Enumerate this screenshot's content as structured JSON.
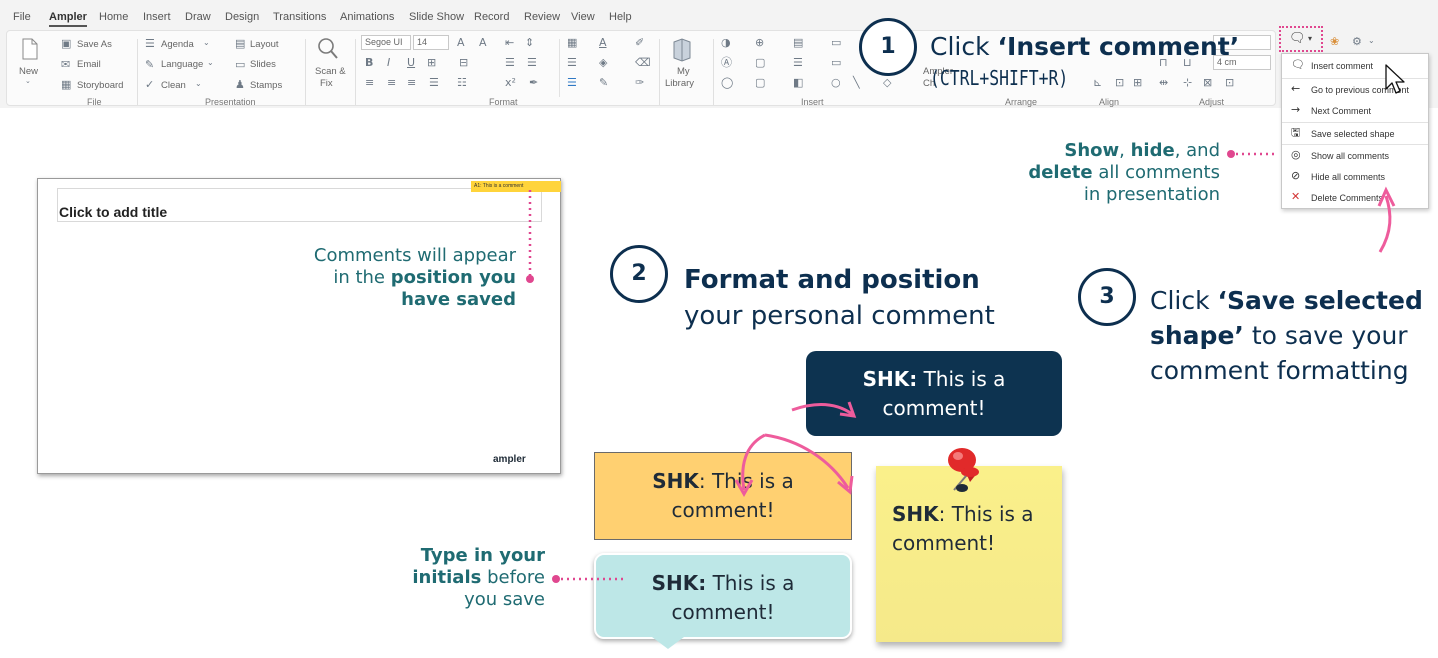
{
  "menu": {
    "tabs": [
      "File",
      "Ampler",
      "Home",
      "Insert",
      "Draw",
      "Design",
      "Transitions",
      "Animations",
      "Slide Show",
      "Record",
      "Review",
      "View",
      "Help"
    ],
    "active": "Ampler"
  },
  "ribbon": {
    "file_group": {
      "new": "New",
      "save_as": "Save As",
      "email": "Email",
      "storyboard": "Storyboard",
      "label": "File"
    },
    "presentation_group": {
      "agenda": "Agenda",
      "language": "Language",
      "clean": "Clean",
      "layout": "Layout",
      "slides": "Slides",
      "stamps": "Stamps",
      "label": "Presentation"
    },
    "scan_fix": {
      "line1": "Scan &",
      "line2": "Fix"
    },
    "format_group": {
      "font": "Segoe UI",
      "size": "14",
      "label": "Format"
    },
    "library": {
      "line1": "My",
      "line2": "Library"
    },
    "insert_label": "Insert",
    "ampler_ch": {
      "line1": "Ampler",
      "line2": "Ch"
    },
    "arrange_label": "Arrange",
    "align_label": "Align",
    "adjust_label": "Adjust",
    "size_value": "4 cm"
  },
  "comments_menu": {
    "items": [
      {
        "icon": "insert-comment-icon",
        "label": "Insert comment"
      },
      {
        "icon": "arrow-left-icon",
        "label": "Go to previous comment"
      },
      {
        "icon": "arrow-right-icon",
        "label": "Next Comment"
      },
      {
        "icon": "save-shape-icon",
        "label": "Save selected shape"
      },
      {
        "icon": "eye-icon",
        "label": "Show all comments"
      },
      {
        "icon": "eye-off-icon",
        "label": "Hide all comments"
      },
      {
        "icon": "close-icon",
        "label": "Delete Comments"
      }
    ]
  },
  "slide": {
    "title_placeholder": "Click to add title",
    "note": "A1: This is a comment",
    "logo": "ampler"
  },
  "annotations": {
    "position": {
      "line1": "Comments will appear",
      "line2_pre": "in the ",
      "line2_bold": "position you",
      "line3_bold": "have saved"
    },
    "show_hide": {
      "show": "Show",
      "comma1": ", ",
      "hide": "hide",
      "and": ", and",
      "delete": "delete",
      "all_comments": " all comments",
      "in_presentation": "in presentation"
    },
    "initials": {
      "bold1": "Type in your",
      "bold2": "initials",
      "rest2": " before",
      "line3": "you save"
    }
  },
  "steps": [
    {
      "number": "1",
      "pre": "Click ",
      "bold": "‘Insert comment’",
      "shortcut": "(CTRL+SHIFT+R)"
    },
    {
      "number": "2",
      "bold": "Format and position",
      "line2": "your personal comment"
    },
    {
      "number": "3",
      "pre": "Click ",
      "bold1": "‘Save selected",
      "bold2": "shape’",
      "rest2": " to save your",
      "line3": "comment formatting"
    }
  ],
  "comment_samples": {
    "navy": {
      "initials": "SHK:",
      "text1": " This is a",
      "text2": "comment!"
    },
    "orange": {
      "initials": "SHK",
      "text1": ": This is a",
      "text2": "comment!"
    },
    "teal": {
      "initials": "SHK:",
      "text1": " This is a",
      "text2": "comment!"
    },
    "sticky": {
      "initials": "SHK",
      "text1": ": This is a",
      "text2": "comment!"
    }
  },
  "colors": {
    "navy": "#0d2f4f",
    "teal_text": "#1f6b72",
    "pink_accent": "#e0478f",
    "orange_fill": "#ffd071",
    "teal_fill": "#bde7e7",
    "sticky_fill": "#f8ee8a",
    "note_yellow": "#ffd43b"
  }
}
